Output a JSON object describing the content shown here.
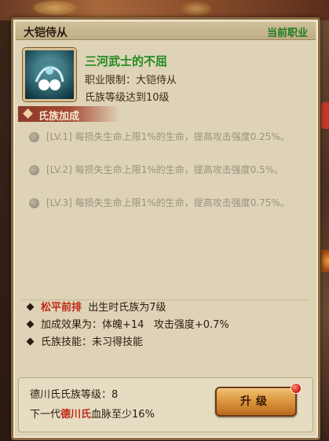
{
  "panel": {
    "title": "大铠侍从",
    "status": "当前职业"
  },
  "skill": {
    "icon": "spirit-skill-icon",
    "name": "三河武士的不屈",
    "requirement": "职业限制：大铠侍从",
    "level_req": "氏族等级达到10级"
  },
  "clan_bonus": {
    "label": "氏族加成",
    "items": [
      {
        "text": "[LV.1] 每损失生命上限1%的生命，提高攻击强度0.25%。"
      },
      {
        "text": "[LV.2] 每损失生命上限1%的生命，提高攻击强度0.5%。"
      },
      {
        "text": "[LV.3] 每损失生命上限1%的生命，提高攻击强度0.75%。"
      }
    ]
  },
  "info": {
    "row1_red": "松平前排",
    "row1_text": "出生时氏族为7级",
    "row2": "加成效果为：体魄+14   攻击强度+0.7%",
    "row3": "氏族技能：未习得技能"
  },
  "bottom": {
    "clan_level": "德川氏氏族等级：8",
    "next_prefix": "下一代",
    "next_clan": "德川氏",
    "next_suffix": "血脉至少16%",
    "upgrade_label": "升级"
  },
  "colors": {
    "accent_green": "#1e8a1e",
    "accent_red": "#c02a18",
    "panel_bg": "#ded3b6"
  }
}
